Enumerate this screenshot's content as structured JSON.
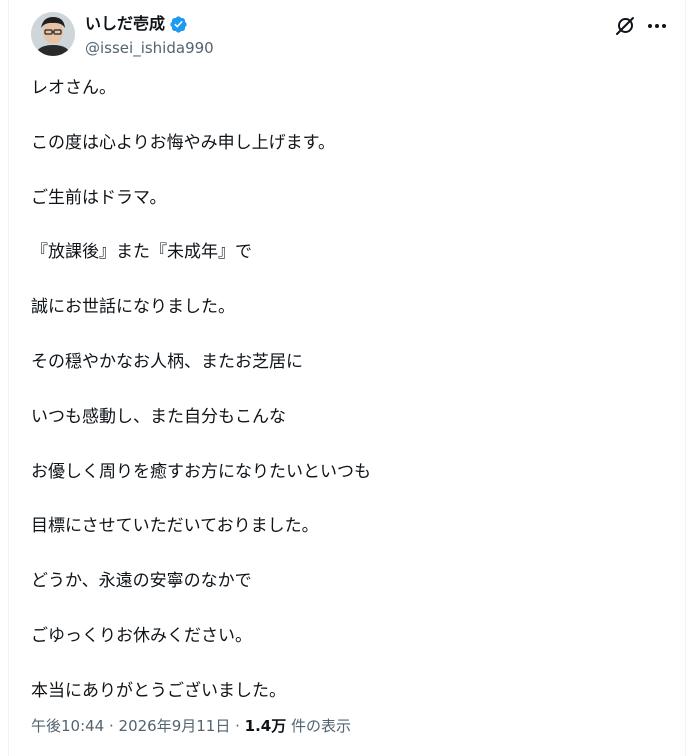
{
  "author": {
    "display_name": "いしだ壱成",
    "handle": "@issei_ishida990",
    "verified": true
  },
  "post": {
    "lines": [
      "レオさん。",
      "この度は心よりお悔やみ申し上げます。",
      "ご生前はドラマ。",
      "『放課後』また『未成年』で",
      "誠にお世話になりました。",
      "その穏やかなお人柄、またお芝居に",
      "いつも感動し、また自分もこんな",
      "お優しく周りを癒すお方になりたいといつも",
      "目標にさせていただいておりました。",
      "どうか、永遠の安寧のなかで",
      "ごゆっくりお休みください。",
      "本当にありがとうございました。"
    ]
  },
  "meta": {
    "time": "午後10:44",
    "sep1": " · ",
    "date": "2026年9月11日",
    "sep2": " · ",
    "views_count": "1.4万",
    "views_label": " 件の表示"
  },
  "icons": {
    "verified": "verified-badge-icon",
    "grok": "grok-icon",
    "more": "more-icon"
  },
  "colors": {
    "text_primary": "#0f1419",
    "text_secondary": "#536471",
    "verified_blue": "#1d9bf0"
  }
}
